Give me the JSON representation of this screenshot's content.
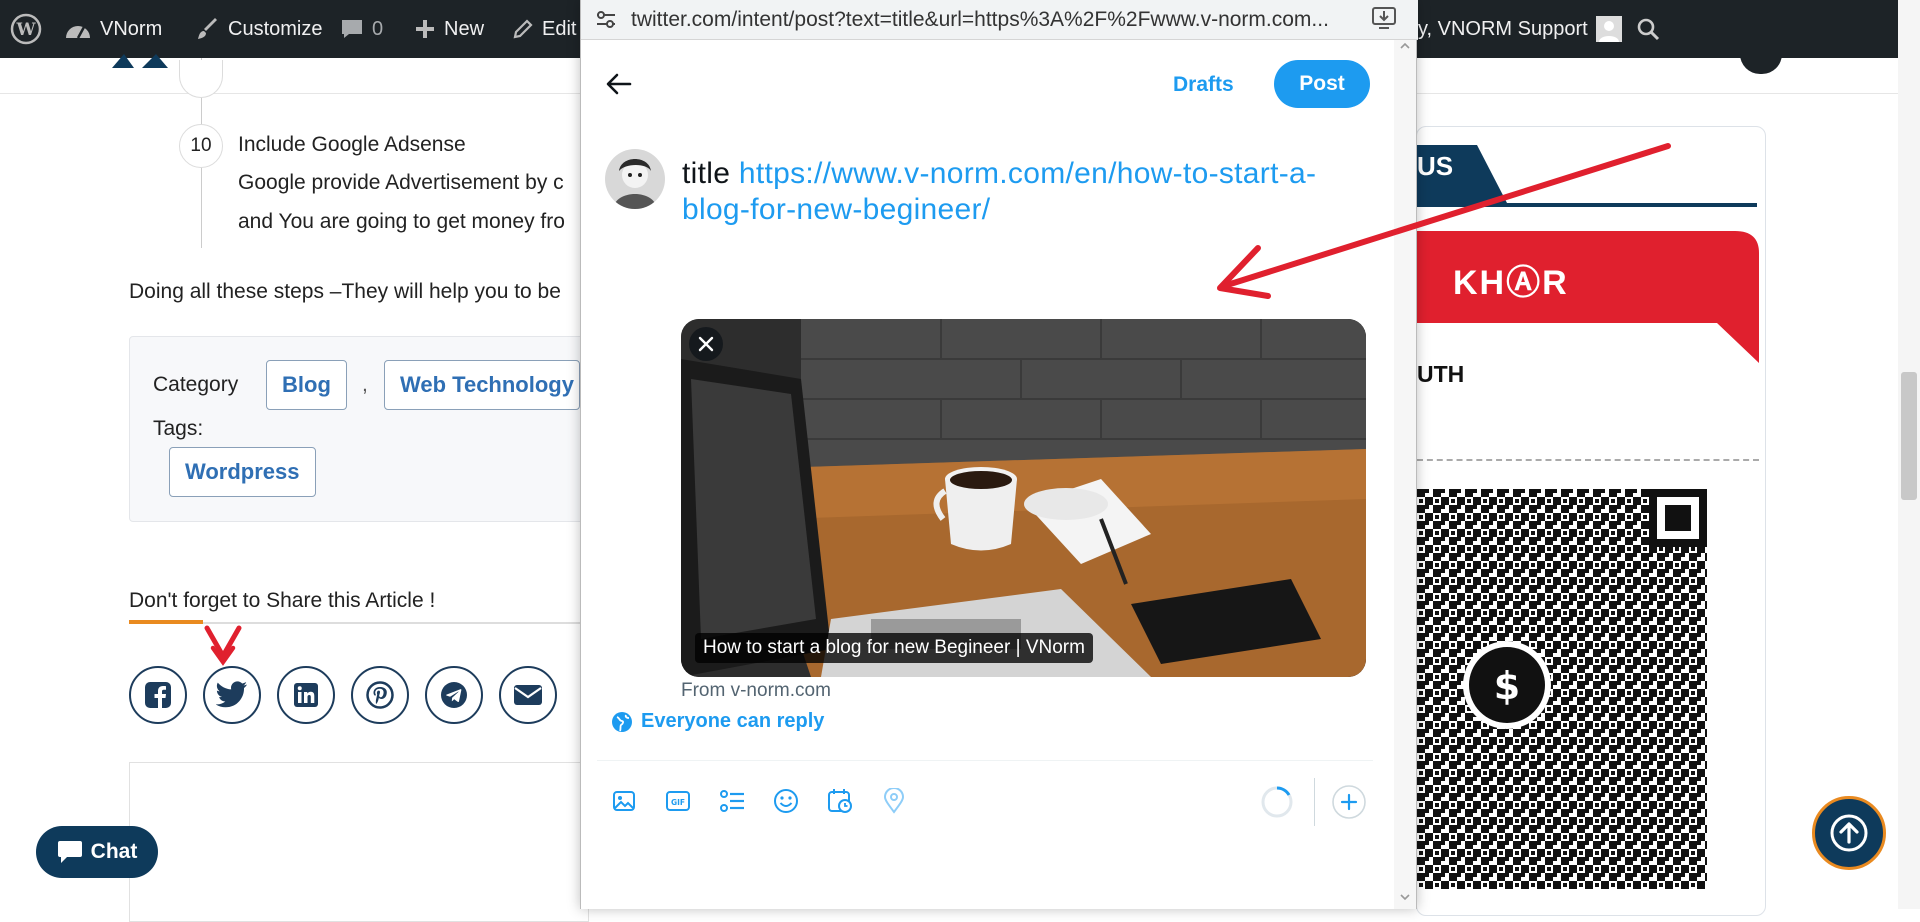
{
  "admin_bar": {
    "site_name": "VNorm",
    "customize": "Customize",
    "comments_count": "0",
    "new_label": "New",
    "edit_label": "Edit",
    "user_greeting": "y, VNORM Support"
  },
  "article": {
    "step_number": "10",
    "step_title": "Include Google Adsense",
    "step_desc_line1": "Google provide Advertisement by c",
    "step_desc_line2": "and You are going to get money fro",
    "summary": "Doing all these steps –They will help you to be",
    "category_label": "Category",
    "categories": [
      "Blog",
      "Web Technology"
    ],
    "category_separator": ",",
    "tags_label": "Tags:",
    "tags": [
      "Wordpress"
    ],
    "share_heading": "Don't forget to Share this Article !"
  },
  "share_buttons": [
    "facebook-icon",
    "twitter-icon",
    "linkedin-icon",
    "pinterest-icon",
    "telegram-icon",
    "email-icon"
  ],
  "sidebar": {
    "banner_text": "US",
    "khqr_text": "KHⒶR",
    "name_fragment": "UTH"
  },
  "chat": {
    "label": "Chat"
  },
  "popup": {
    "url": "twitter.com/intent/post?text=title&url=https%3A%2F%2Fwww.v-norm.com...",
    "drafts_label": "Drafts",
    "post_label": "Post",
    "tweet_title": "title",
    "tweet_link": "https://www.v-norm.com/en/how-to-start-a-blog-for-new-begineer/",
    "card_caption": "How to start a blog for new Begineer | VNorm",
    "card_source": "From v-norm.com",
    "reply_setting": "Everyone can reply",
    "toolbar_icons": [
      "image-icon",
      "gif-icon",
      "poll-icon",
      "emoji-icon",
      "schedule-icon",
      "location-icon"
    ]
  },
  "colors": {
    "twitter_blue": "#1d9bf0",
    "admin_bar": "#1d2327",
    "navy": "#0e3a5b",
    "accent_orange": "#e98a20",
    "annotation_red": "#e0202e"
  }
}
